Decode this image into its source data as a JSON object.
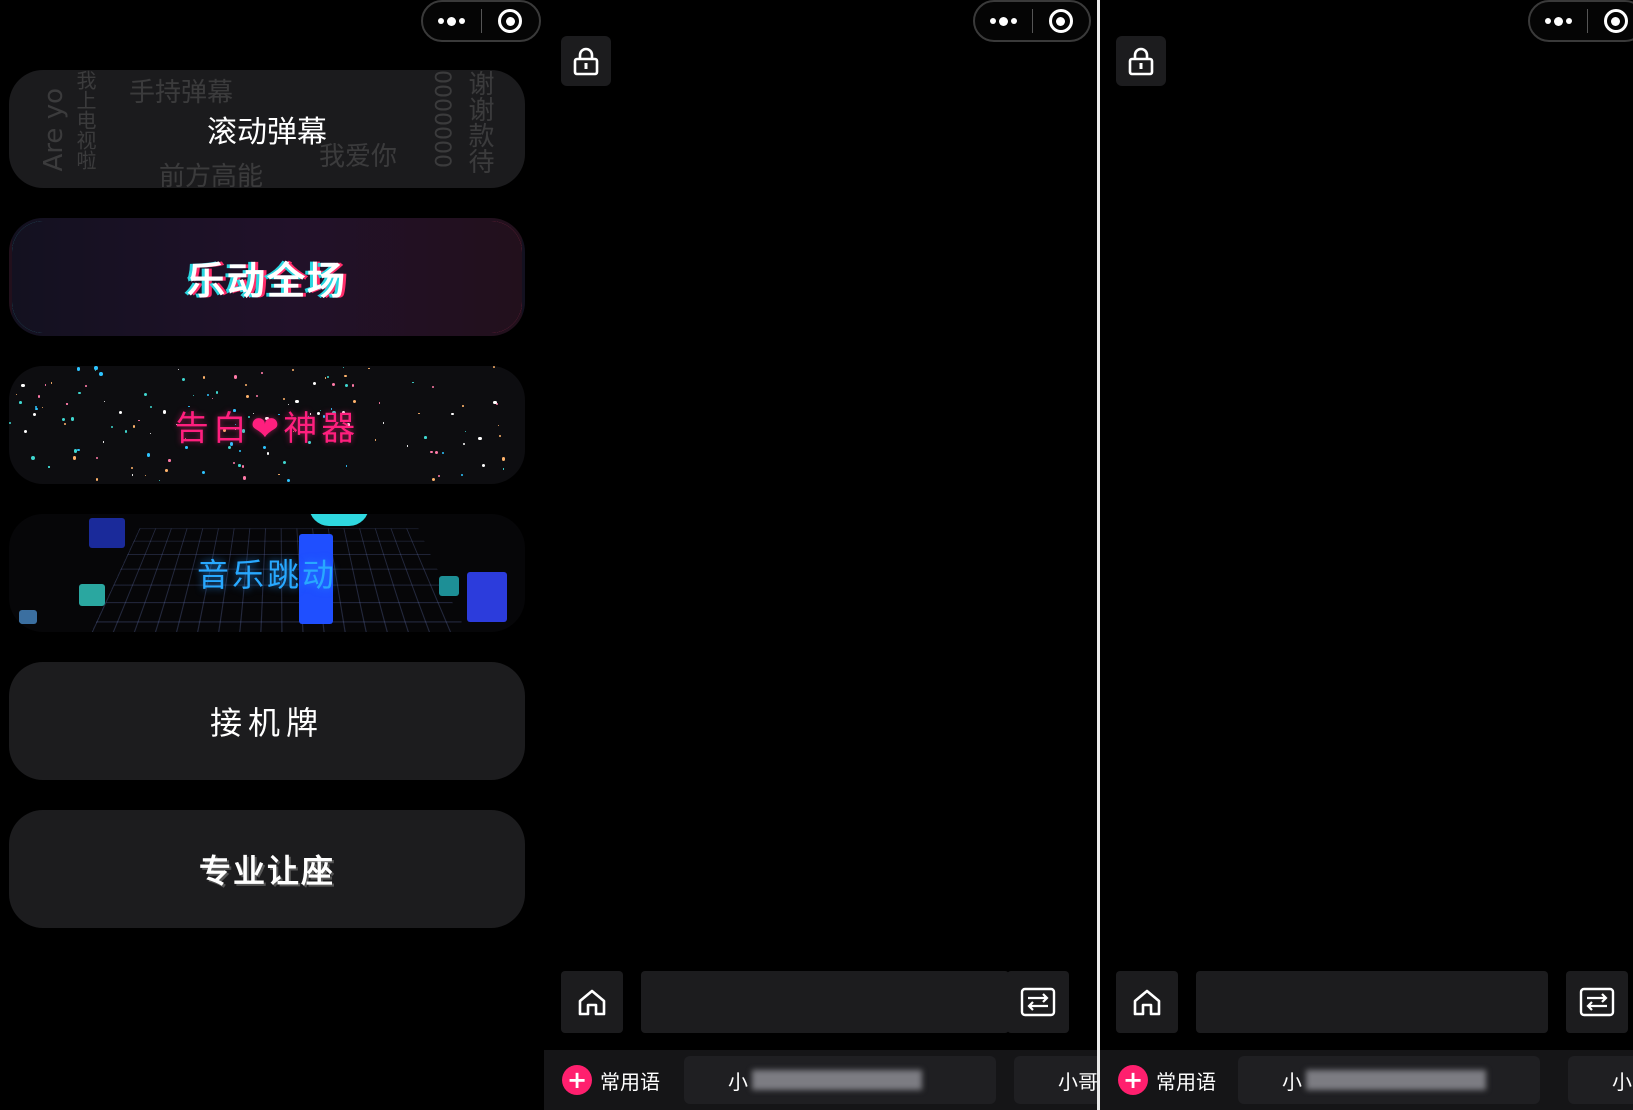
{
  "menu": {
    "cards": [
      {
        "id": "danmu",
        "label": "滚动弹幕"
      },
      {
        "id": "ledong",
        "label": "乐动全场"
      },
      {
        "id": "gaobai",
        "label": "告白❤神器"
      },
      {
        "id": "music",
        "label": "音乐跳动"
      },
      {
        "id": "jieji",
        "label": "接机牌"
      },
      {
        "id": "rangzuo",
        "label": "专业让座"
      }
    ],
    "danmu_background": [
      "手持弹幕",
      "前方高能",
      "我爱你",
      "Are yo",
      "我上电视啦",
      "谢谢款待",
      "0000000"
    ]
  },
  "editor": {
    "common_phrases_label": "常用语",
    "chip_1_prefix": "小",
    "chip_2_prefix_screen2": "小哥",
    "chip_2_prefix_screen3": "小"
  },
  "icons": {
    "more": "more-icon",
    "target": "target-icon",
    "lock": "lock-icon",
    "home": "home-icon",
    "switch": "switch-icon",
    "plus": "plus-icon"
  },
  "colors": {
    "accent_pink": "#ff1f6e",
    "accent_cyan": "#2ed3d7",
    "music_blue": "#28a8ff"
  }
}
